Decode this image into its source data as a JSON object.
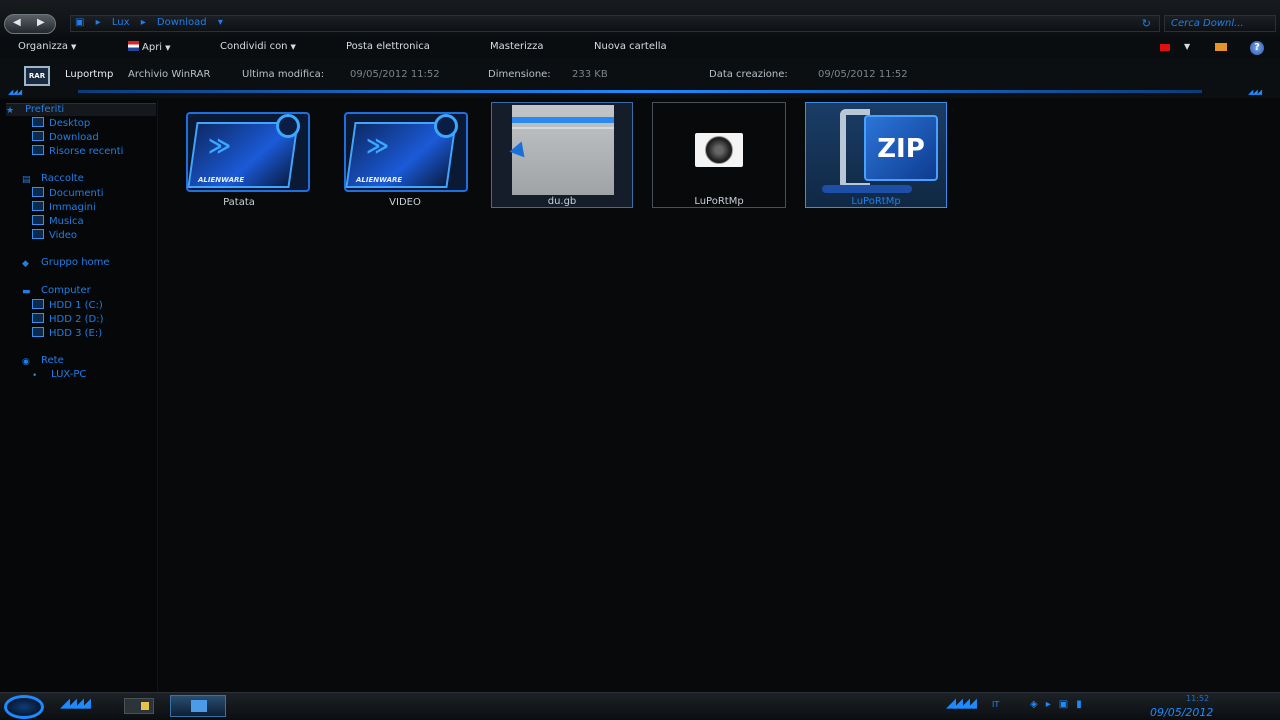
{
  "address": {
    "crumbs": [
      "Lux",
      "Download"
    ],
    "search_placeholder": "Cerca Downl..."
  },
  "toolbar": {
    "organize": "Organizza",
    "open": "Apri",
    "share": "Condividi con",
    "email": "Posta elettronica",
    "burn": "Masterizza",
    "new_folder": "Nuova cartella"
  },
  "details": {
    "name": "Luportmp",
    "type": "Archivio WinRAR",
    "modified_label": "Ultima modifica:",
    "modified": "09/05/2012 11:52",
    "size_label": "Dimensione:",
    "size": "233 KB",
    "created_label": "Data creazione:",
    "created": "09/05/2012 11:52"
  },
  "sidebar": {
    "favorites": "Preferiti",
    "favorites_items": [
      "Desktop",
      "Download",
      "Risorse recenti"
    ],
    "libraries": "Raccolte",
    "libraries_items": [
      "Documenti",
      "Immagini",
      "Musica",
      "Video"
    ],
    "homegroup": "Gruppo home",
    "computer": "Computer",
    "computer_items": [
      "HDD 1 (C:)",
      "HDD 2 (D:)",
      "HDD 3 (E:)"
    ],
    "network": "Rete",
    "network_items": [
      "LUX-PC"
    ]
  },
  "files": [
    {
      "label": "Patata",
      "brand": "ALIENWARE"
    },
    {
      "label": "VIDEO",
      "brand": "ALIENWARE"
    },
    {
      "label": "du.gb"
    },
    {
      "label": "LuPoRtMp"
    },
    {
      "label": "LuPoRtMp",
      "thumb_text": "ZIP"
    }
  ],
  "taskbar": {
    "language": "IT",
    "time": "11:52",
    "date": "09/05/2012"
  },
  "colors": {
    "accent": "#1d8bff",
    "background": "#07090b"
  }
}
